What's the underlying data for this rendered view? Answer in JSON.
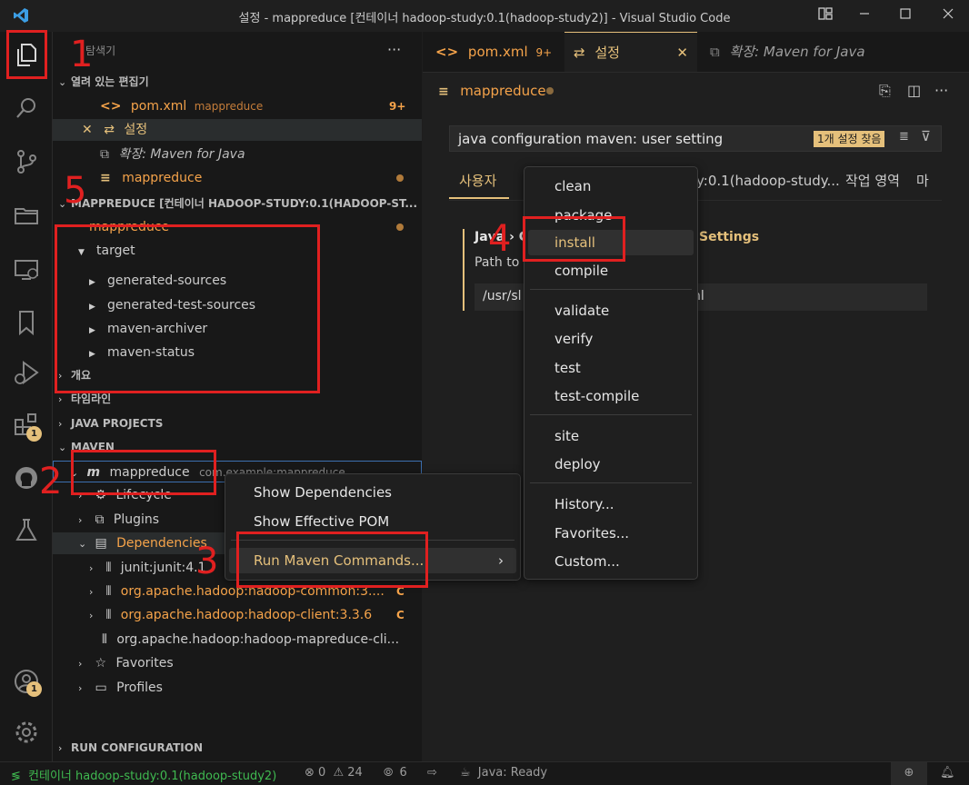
{
  "window": {
    "title": "설정 - mappreduce [컨테이너 hadoop-study:0.1(hadoop-study2)] - Visual Studio Code"
  },
  "activity_bar": {
    "extensions_badge": "1",
    "accounts_badge": "1"
  },
  "sidebar": {
    "header": "탐색기",
    "open_editors": {
      "title": "열려 있는 편집기",
      "items": [
        {
          "name": "pom.xml",
          "detail": "mappreduce",
          "badge": "9+"
        },
        {
          "name": "설정",
          "detail": ""
        },
        {
          "name": "확장: Maven for Java",
          "detail": ""
        },
        {
          "name": "mappreduce",
          "detail": ""
        }
      ]
    },
    "workspace": {
      "title": "MAPPREDUCE [컨테이너 HADOOP-STUDY:0.1(HADOOP-ST...",
      "root": "mappreduce",
      "target": "target",
      "children": [
        "generated-sources",
        "generated-test-sources",
        "maven-archiver",
        "maven-status"
      ]
    },
    "outline": "개요",
    "timeline": "타임라인",
    "java_projects": "JAVA PROJECTS",
    "maven": {
      "title": "MAVEN",
      "project": "mappreduce",
      "project_detail": "com.example:mappreduce",
      "lifecycle": "Lifecycle",
      "plugins": "Plugins",
      "dependencies": "Dependencies",
      "deps": [
        {
          "name": "junit:junit:4.1",
          "flag": ""
        },
        {
          "name": "org.apache.hadoop:hadoop-common:3....",
          "flag": "C"
        },
        {
          "name": "org.apache.hadoop:hadoop-client:3.3.6",
          "flag": "C"
        },
        {
          "name": "org.apache.hadoop:hadoop-mapreduce-cli...",
          "flag": ""
        }
      ],
      "favorites": "Favorites",
      "profiles": "Profiles"
    },
    "run_configuration": "RUN CONFIGURATION"
  },
  "editor": {
    "tabs": [
      {
        "label": "pom.xml",
        "badge": "9+"
      },
      {
        "label": "설정"
      },
      {
        "label": "확장: Maven for Java"
      }
    ],
    "breadcrumb": "mappreduce",
    "search": {
      "value": "java configuration maven: user setting",
      "result": "1개 설정 찾음"
    },
    "scope_tabs": [
      "사용자",
      "y:0.1(hadoop-study...",
      "작업 영역",
      "마"
    ],
    "setting": {
      "title_prefix": "Java › C",
      "title_suffix": "Settings",
      "description": "Path to",
      "value_prefix": "/usr/sl",
      "value_suffix": "nl"
    }
  },
  "context_menu": {
    "items": [
      "Show Dependencies",
      "Show Effective POM",
      "Run Maven Commands..."
    ]
  },
  "maven_commands": {
    "group1": [
      "clean",
      "package",
      "install",
      "compile"
    ],
    "group2": [
      "validate",
      "verify",
      "test",
      "test-compile"
    ],
    "group3": [
      "site",
      "deploy"
    ],
    "group4": [
      "History...",
      "Favorites...",
      "Custom..."
    ]
  },
  "annotations": [
    "1",
    "2",
    "3",
    "4",
    "5"
  ],
  "statusbar": {
    "remote": "컨테이너 hadoop-study:0.1(hadoop-study2)",
    "errors": "0",
    "warnings": "24",
    "ports": "6",
    "java": "Java: Ready"
  },
  "colors": {
    "accent_orange": "#f5a34a",
    "highlight_yellow": "#e5c07b",
    "annotation_red": "#e02020",
    "remote_green": "#3fb950"
  }
}
